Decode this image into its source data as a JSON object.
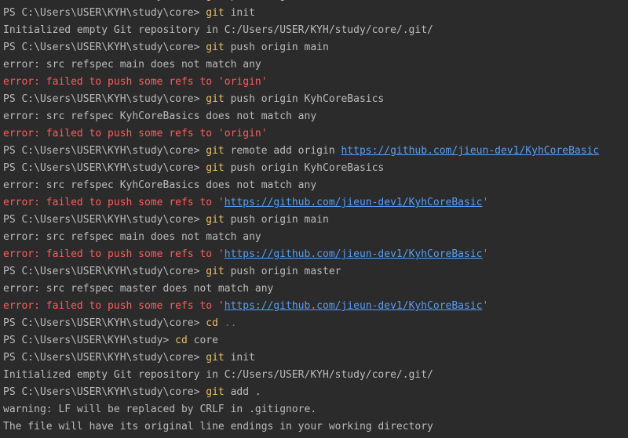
{
  "colors": {
    "background": "#2b2b2b",
    "text": "#bbbbbb",
    "command": "#e8bf6a",
    "error": "#ff5b5b",
    "link": "#589df6",
    "dim": "#6e6e6e"
  },
  "lines": [
    [
      {
        "t": "PS C:\\Users\\USER\\KYH\\study\\core> ",
        "s": "plain"
      },
      {
        "t": "git ",
        "s": "cmd"
      },
      {
        "t": "push origin main",
        "s": "plain"
      }
    ],
    [
      {
        "t": "PS C:\\Users\\USER\\KYH\\study\\core> ",
        "s": "plain"
      },
      {
        "t": "git ",
        "s": "cmd"
      },
      {
        "t": "init",
        "s": "plain"
      }
    ],
    [
      {
        "t": "Initialized empty Git repository in C:/Users/USER/KYH/study/core/.git/",
        "s": "plain"
      }
    ],
    [
      {
        "t": "PS C:\\Users\\USER\\KYH\\study\\core> ",
        "s": "plain"
      },
      {
        "t": "git ",
        "s": "cmd"
      },
      {
        "t": "push origin main",
        "s": "plain"
      }
    ],
    [
      {
        "t": "error: src refspec main does not match any",
        "s": "plain"
      }
    ],
    [
      {
        "t": "error: failed to push some refs to 'origin'",
        "s": "err"
      }
    ],
    [
      {
        "t": "PS C:\\Users\\USER\\KYH\\study\\core> ",
        "s": "plain"
      },
      {
        "t": "git ",
        "s": "cmd"
      },
      {
        "t": "push origin KyhCoreBasics",
        "s": "plain"
      }
    ],
    [
      {
        "t": "error: src refspec KyhCoreBasics does not match any",
        "s": "plain"
      }
    ],
    [
      {
        "t": "error: failed to push some refs to 'origin'",
        "s": "err"
      }
    ],
    [
      {
        "t": "PS C:\\Users\\USER\\KYH\\study\\core> ",
        "s": "plain"
      },
      {
        "t": "git ",
        "s": "cmd"
      },
      {
        "t": "remote add origin ",
        "s": "plain"
      },
      {
        "t": "https://github.com/jieun-dev1/KyhCoreBasic",
        "s": "link"
      }
    ],
    [
      {
        "t": "PS C:\\Users\\USER\\KYH\\study\\core> ",
        "s": "plain"
      },
      {
        "t": "git ",
        "s": "cmd"
      },
      {
        "t": "push origin KyhCoreBasics",
        "s": "plain"
      }
    ],
    [
      {
        "t": "error: src refspec KyhCoreBasics does not match any",
        "s": "plain"
      }
    ],
    [
      {
        "t": "error: failed to push some refs to '",
        "s": "err"
      },
      {
        "t": "https://github.com/jieun-dev1/KyhCoreBasic",
        "s": "link"
      },
      {
        "t": "'",
        "s": "err"
      }
    ],
    [
      {
        "t": "PS C:\\Users\\USER\\KYH\\study\\core> ",
        "s": "plain"
      },
      {
        "t": "git ",
        "s": "cmd"
      },
      {
        "t": "push origin main",
        "s": "plain"
      }
    ],
    [
      {
        "t": "error: src refspec main does not match any",
        "s": "plain"
      }
    ],
    [
      {
        "t": "error: failed to push some refs to '",
        "s": "err"
      },
      {
        "t": "https://github.com/jieun-dev1/KyhCoreBasic",
        "s": "link"
      },
      {
        "t": "'",
        "s": "err"
      }
    ],
    [
      {
        "t": "PS C:\\Users\\USER\\KYH\\study\\core> ",
        "s": "plain"
      },
      {
        "t": "git ",
        "s": "cmd"
      },
      {
        "t": "push origin master",
        "s": "plain"
      }
    ],
    [
      {
        "t": "error: src refspec master does not match any",
        "s": "plain"
      }
    ],
    [
      {
        "t": "error: failed to push some refs to '",
        "s": "err"
      },
      {
        "t": "https://github.com/jieun-dev1/KyhCoreBasic",
        "s": "link"
      },
      {
        "t": "'",
        "s": "err"
      }
    ],
    [
      {
        "t": "PS C:\\Users\\USER\\KYH\\study\\core> ",
        "s": "plain"
      },
      {
        "t": "cd ",
        "s": "cmd"
      },
      {
        "t": "..",
        "s": "dim"
      }
    ],
    [
      {
        "t": "PS C:\\Users\\USER\\KYH\\study> ",
        "s": "plain"
      },
      {
        "t": "cd ",
        "s": "cmd"
      },
      {
        "t": "core",
        "s": "plain"
      }
    ],
    [
      {
        "t": "PS C:\\Users\\USER\\KYH\\study\\core> ",
        "s": "plain"
      },
      {
        "t": "git ",
        "s": "cmd"
      },
      {
        "t": "init",
        "s": "plain"
      }
    ],
    [
      {
        "t": "Initialized empty Git repository in C:/Users/USER/KYH/study/core/.git/",
        "s": "plain"
      }
    ],
    [
      {
        "t": "PS C:\\Users\\USER\\KYH\\study\\core> ",
        "s": "plain"
      },
      {
        "t": "git ",
        "s": "cmd"
      },
      {
        "t": "add .",
        "s": "plain"
      }
    ],
    [
      {
        "t": "warning: LF will be replaced by CRLF in .gitignore.",
        "s": "plain"
      }
    ],
    [
      {
        "t": "The file will have its original line endings in your working directory",
        "s": "plain"
      }
    ]
  ]
}
